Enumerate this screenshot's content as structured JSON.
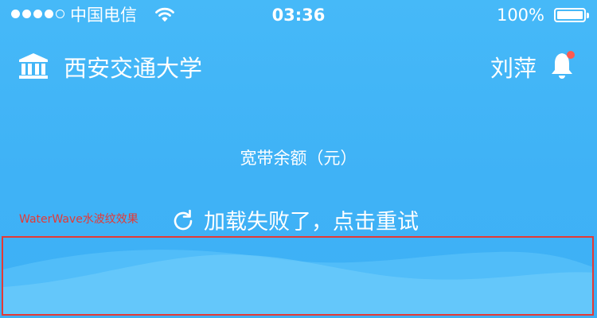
{
  "status_bar": {
    "carrier": "中国电信",
    "time": "03:36",
    "battery_percent": "100%",
    "battery_level": 1.0,
    "signal_bars_filled": 4,
    "signal_bars_total": 5,
    "icons": [
      "wifi-icon",
      "battery-icon"
    ]
  },
  "header": {
    "school_name": "西安交通大学",
    "user_name": "刘萍",
    "icons": [
      "university-icon",
      "bell-icon"
    ],
    "notification_dot_color": "#ff5a4f"
  },
  "balance": {
    "label": "宽带余额（元）"
  },
  "retry": {
    "icon": "refresh-icon",
    "text": "加载失败了，点击重试"
  },
  "annotation": {
    "text": "WaterWave水波纹效果",
    "color": "#e53935"
  },
  "colors": {
    "background": "#3fb2f6",
    "text": "#ffffff"
  }
}
